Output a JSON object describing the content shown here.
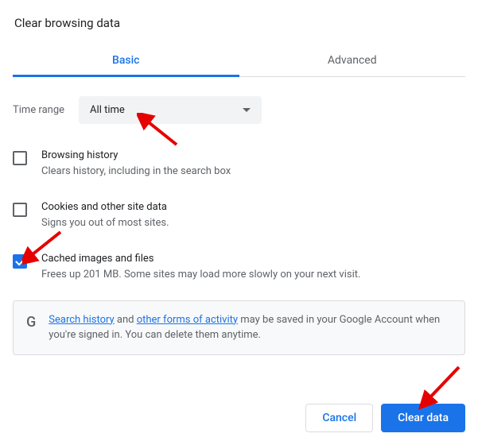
{
  "dialog": {
    "title": "Clear browsing data"
  },
  "tabs": {
    "basic": "Basic",
    "advanced": "Advanced"
  },
  "time": {
    "label": "Time range",
    "value": "All time"
  },
  "options": [
    {
      "checked": false,
      "primary": "Browsing history",
      "secondary": "Clears history, including in the search box"
    },
    {
      "checked": false,
      "primary": "Cookies and other site data",
      "secondary": "Signs you out of most sites."
    },
    {
      "checked": true,
      "primary": "Cached images and files",
      "secondary": "Frees up 201 MB. Some sites may load more slowly on your next visit."
    }
  ],
  "notice": {
    "link1": "Search history",
    "mid1": " and ",
    "link2": "other forms of activity",
    "rest": " may be saved in your Google Account when you're signed in. You can delete them anytime."
  },
  "buttons": {
    "cancel": "Cancel",
    "clear": "Clear data"
  }
}
